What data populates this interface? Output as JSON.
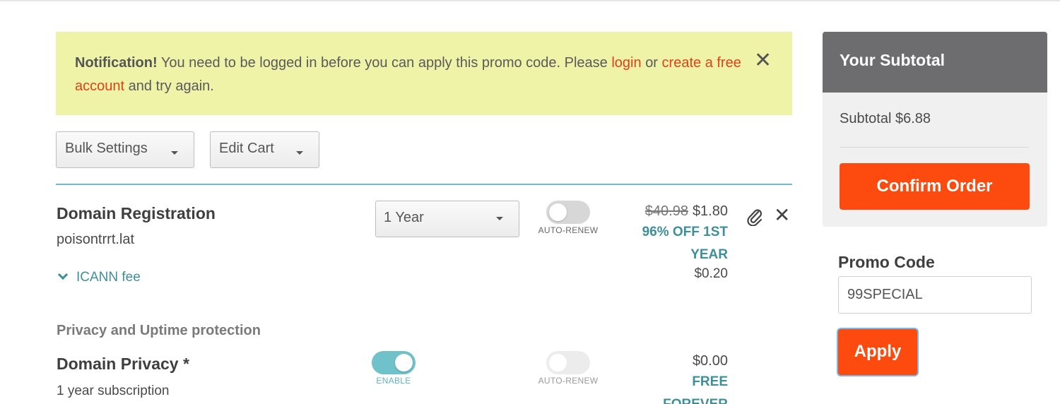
{
  "notification": {
    "title": "Notification!",
    "message_before": "You need to be logged in before you can apply this promo code. Please",
    "login_link": "login",
    "or_text": "or",
    "create_link": "create a free account",
    "message_after": "and try again.",
    "close_icon": "close-icon"
  },
  "toolbar": {
    "bulk_label": "Bulk Settings",
    "edit_label": "Edit Cart"
  },
  "items": [
    {
      "title": "Domain Registration",
      "subtitle": "poisontrrt.lat",
      "icann_label": "ICANN fee",
      "term": "1 Year",
      "auto_renew_label": "AUTO-RENEW",
      "auto_renew": false,
      "old_price": "$40.98",
      "price": "$1.80",
      "discount_line1": "96% OFF 1ST",
      "discount_line2": "YEAR",
      "icann_price": "$0.20"
    },
    {
      "section": "Privacy and Uptime protection",
      "title": "Domain Privacy *",
      "subtitle": "1 year subscription",
      "enable_label": "ENABLE",
      "enabled": true,
      "auto_renew_label": "AUTO-RENEW",
      "price": "$0.00",
      "free_label": "FREE",
      "free_suffix": "FOREVER"
    }
  ],
  "sidebar": {
    "heading": "Your Subtotal",
    "subtotal_text": "Subtotal $6.88",
    "confirm_label": "Confirm Order",
    "promo_label": "Promo Code",
    "promo_value": "99SPECIAL",
    "apply_label": "Apply"
  },
  "colors": {
    "accent": "#fd4b10",
    "teal": "#3e8f9a",
    "notice_bg": "#eff3a8",
    "link": "#e0401a"
  }
}
